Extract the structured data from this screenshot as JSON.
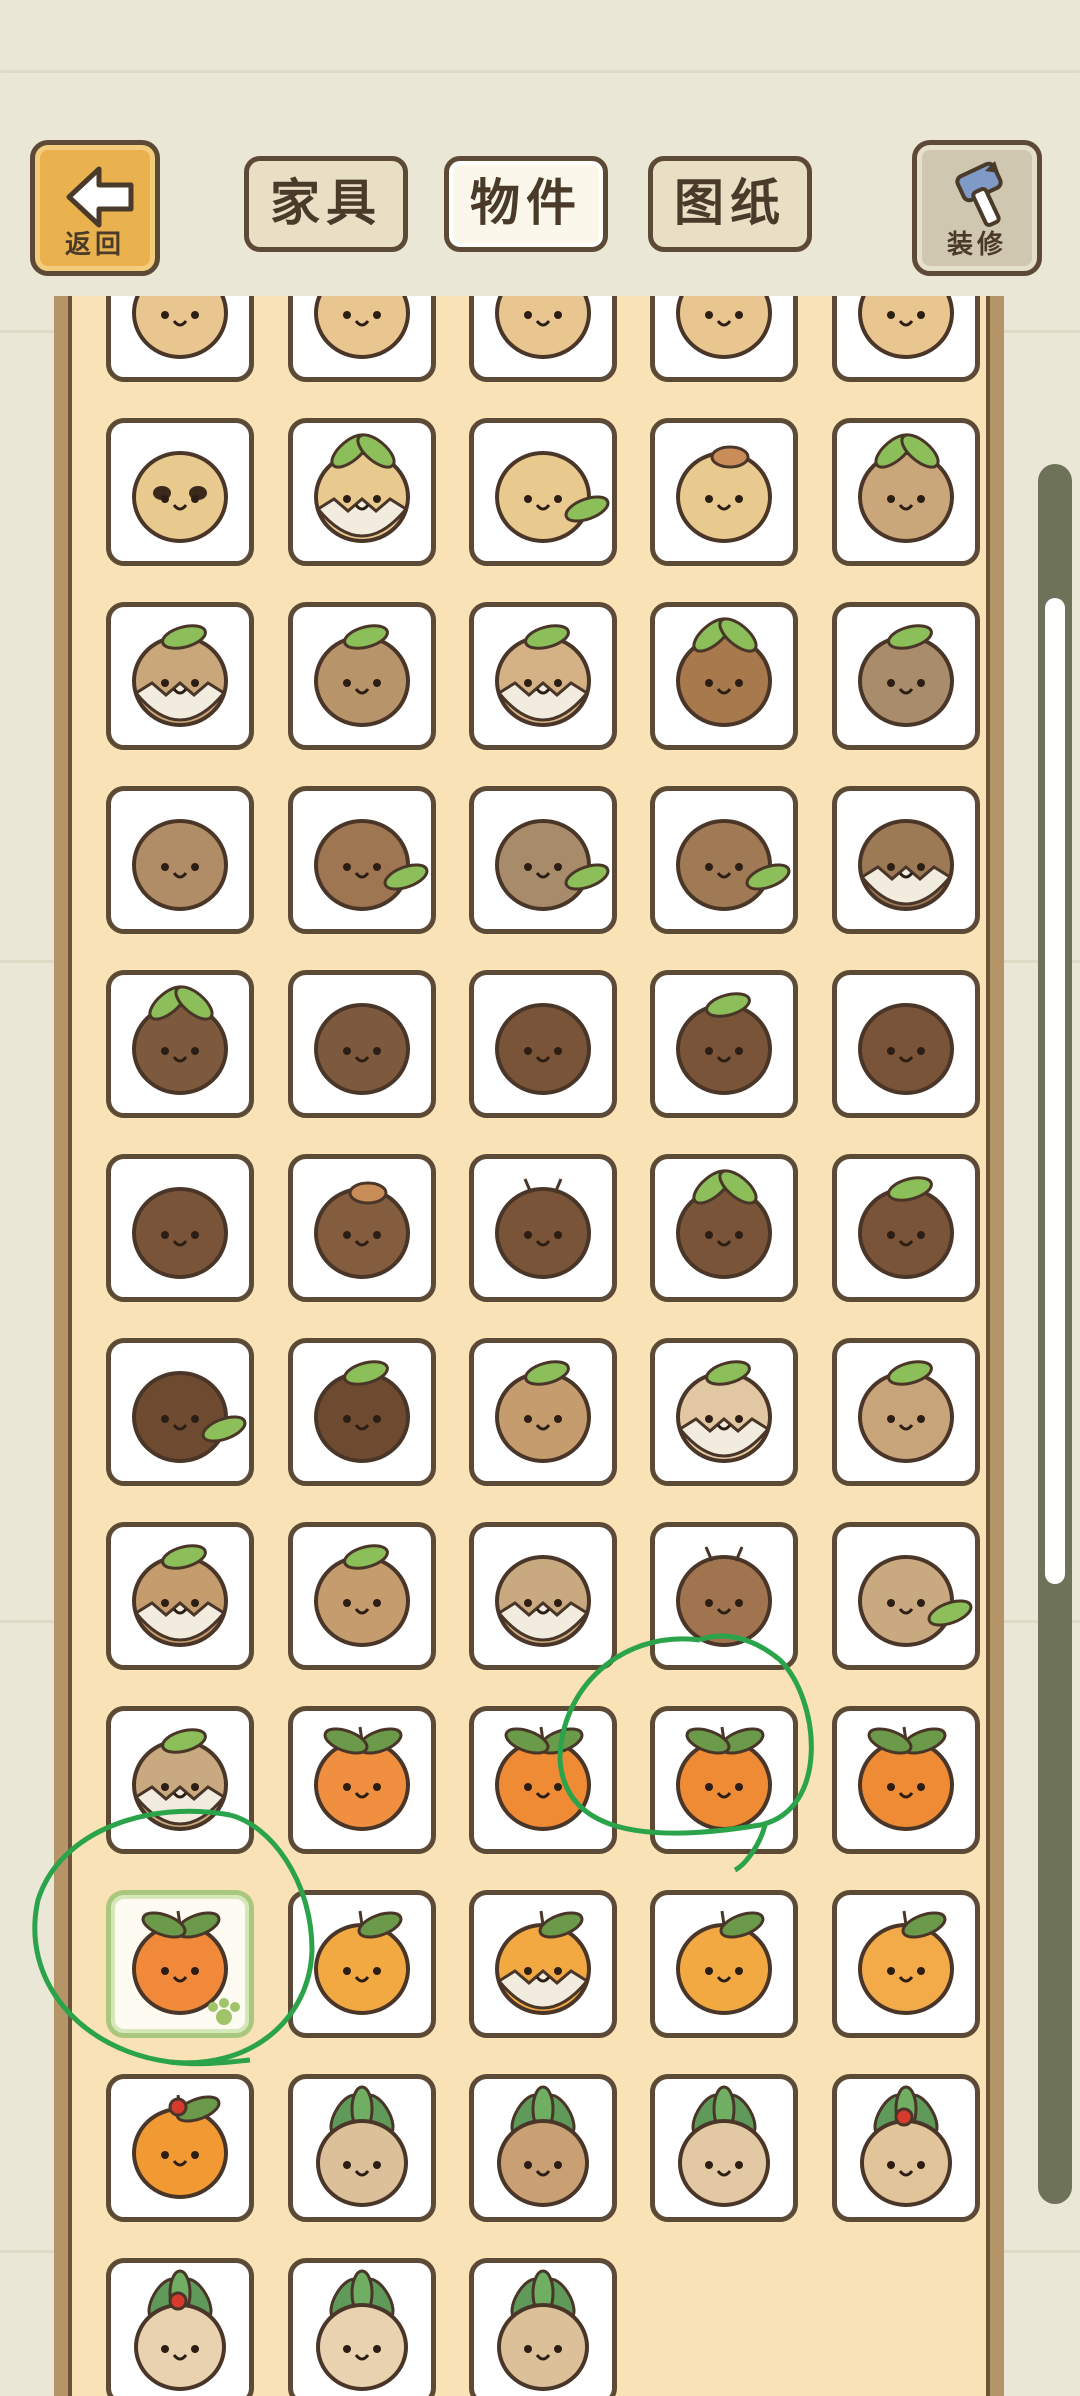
{
  "header": {
    "back_label": "返回",
    "tabs": [
      {
        "label": "家具",
        "active": false
      },
      {
        "label": "物件",
        "active": true
      },
      {
        "label": "图纸",
        "active": false
      }
    ],
    "decor_label": "装修"
  },
  "grid": {
    "columns": 5,
    "selected_index": 45,
    "items": [
      {
        "body": "#e9c690",
        "style": "plain",
        "icon": "nut-item"
      },
      {
        "body": "#e9c690",
        "style": "plain",
        "icon": "nut-item"
      },
      {
        "body": "#e9c690",
        "style": "plain",
        "icon": "nut-item"
      },
      {
        "body": "#e9c690",
        "style": "plain",
        "icon": "nut-item"
      },
      {
        "body": "#e9c690",
        "style": "plain",
        "icon": "nut-item"
      },
      {
        "body": "#e8c98e",
        "style": "panda",
        "icon": "nut-panda-icon"
      },
      {
        "body": "#e8c98e",
        "style": "sprout-shell",
        "icon": "nut-sprout-shell-icon"
      },
      {
        "body": "#e8c98e",
        "style": "side-leaf",
        "icon": "nut-side-leaf-icon"
      },
      {
        "body": "#e8c98e",
        "style": "mushroom-hat",
        "icon": "nut-mushroom-icon"
      },
      {
        "body": "#c9a77a",
        "style": "sprout",
        "icon": "nut-sprout-icon"
      },
      {
        "body": "#c9a77a",
        "style": "leaf-shell",
        "icon": "nut-leaf-shell-icon"
      },
      {
        "body": "#b8946a",
        "style": "leaf",
        "icon": "nut-leaf-icon"
      },
      {
        "body": "#d4b285",
        "style": "leaf-shell",
        "icon": "nut-leaf-shell-icon"
      },
      {
        "body": "#a8794c",
        "style": "sprout",
        "icon": "nut-sprout-icon"
      },
      {
        "body": "#a98c6b",
        "style": "leaf",
        "icon": "nut-leaf-icon"
      },
      {
        "body": "#b08d66",
        "style": "plain",
        "icon": "nut-plain-icon"
      },
      {
        "body": "#9e7652",
        "style": "side-leaf",
        "icon": "nut-side-leaf-icon"
      },
      {
        "body": "#a88b6a",
        "style": "side-leaf",
        "icon": "nut-side-leaf-icon"
      },
      {
        "body": "#a07a55",
        "style": "side-leaf",
        "icon": "nut-side-leaf-icon"
      },
      {
        "body": "#9c7a55",
        "style": "shell",
        "icon": "nut-shell-icon"
      },
      {
        "body": "#7d5a3e",
        "style": "sprout",
        "icon": "nut-sprout-icon"
      },
      {
        "body": "#7d5a3e",
        "style": "plain",
        "icon": "nut-plain-icon"
      },
      {
        "body": "#7a5438",
        "style": "plain",
        "icon": "nut-plain-icon"
      },
      {
        "body": "#7a5438",
        "style": "leaf",
        "icon": "nut-leaf-icon"
      },
      {
        "body": "#7a5438",
        "style": "plain",
        "icon": "nut-plain-icon"
      },
      {
        "body": "#7a5438",
        "style": "plain",
        "icon": "nut-plain-icon"
      },
      {
        "body": "#845d3e",
        "style": "mushroom-hat",
        "icon": "nut-mushroom-icon"
      },
      {
        "body": "#7a5438",
        "style": "antenna",
        "icon": "nut-antenna-icon"
      },
      {
        "body": "#7a5438",
        "style": "sprout",
        "icon": "nut-sprout-icon"
      },
      {
        "body": "#7a5438",
        "style": "leaf",
        "icon": "nut-leaf-icon"
      },
      {
        "body": "#6e4b30",
        "style": "side-leaf",
        "icon": "nut-side-leaf-icon"
      },
      {
        "body": "#6e4b30",
        "style": "leaf",
        "icon": "nut-leaf-icon"
      },
      {
        "body": "#c49c6e",
        "style": "leaf",
        "icon": "nut-leaf-icon"
      },
      {
        "body": "#e2c8a2",
        "style": "leaf-shell",
        "icon": "nut-leaf-shell-icon"
      },
      {
        "body": "#c8a47a",
        "style": "leaf",
        "icon": "nut-leaf-icon"
      },
      {
        "body": "#c49c6e",
        "style": "leaf-shell",
        "icon": "nut-leaf-shell-icon"
      },
      {
        "body": "#c49c6e",
        "style": "leaf",
        "icon": "nut-leaf-icon"
      },
      {
        "body": "#c9a97f",
        "style": "shell",
        "icon": "nut-shell-icon"
      },
      {
        "body": "#a17450",
        "style": "antenna",
        "icon": "nut-antenna-icon"
      },
      {
        "body": "#c9a97f",
        "style": "side-leaf",
        "icon": "nut-side-leaf-icon"
      },
      {
        "body": "#c9a97f",
        "style": "leaf-shell",
        "icon": "nut-leaf-shell-icon"
      },
      {
        "body": "#ef8f3f",
        "style": "persimmon",
        "icon": "persimmon-icon"
      },
      {
        "body": "#ef8a35",
        "style": "persimmon",
        "icon": "persimmon-icon"
      },
      {
        "body": "#ef8a35",
        "style": "persimmon",
        "icon": "persimmon-icon"
      },
      {
        "body": "#ef8a35",
        "style": "persimmon",
        "icon": "persimmon-icon"
      },
      {
        "body": "#f08a3a",
        "style": "persimmon",
        "icon": "persimmon-icon"
      },
      {
        "body": "#f3a942",
        "style": "orange",
        "icon": "orange-icon"
      },
      {
        "body": "#f3a942",
        "style": "orange-shell",
        "icon": "orange-shell-icon"
      },
      {
        "body": "#f3a942",
        "style": "orange",
        "icon": "orange-icon"
      },
      {
        "body": "#f3aa48",
        "style": "orange",
        "icon": "orange-icon"
      },
      {
        "body": "#f19a33",
        "style": "berry",
        "icon": "berry-orange-icon"
      },
      {
        "body": "#dcc09a",
        "style": "radish",
        "icon": "radish-icon"
      },
      {
        "body": "#c9a074",
        "style": "radish",
        "icon": "radish-icon"
      },
      {
        "body": "#e2c9a3",
        "style": "radish",
        "icon": "radish-icon"
      },
      {
        "body": "#e2c49a",
        "style": "radish-berry",
        "icon": "radish-berry-icon"
      },
      {
        "body": "#e8d2b0",
        "style": "radish-berry",
        "icon": "radish-berry-icon"
      },
      {
        "body": "#e8d2b0",
        "style": "radish",
        "icon": "radish-icon"
      },
      {
        "body": "#dcc09a",
        "style": "radish",
        "icon": "radish-icon"
      }
    ]
  }
}
